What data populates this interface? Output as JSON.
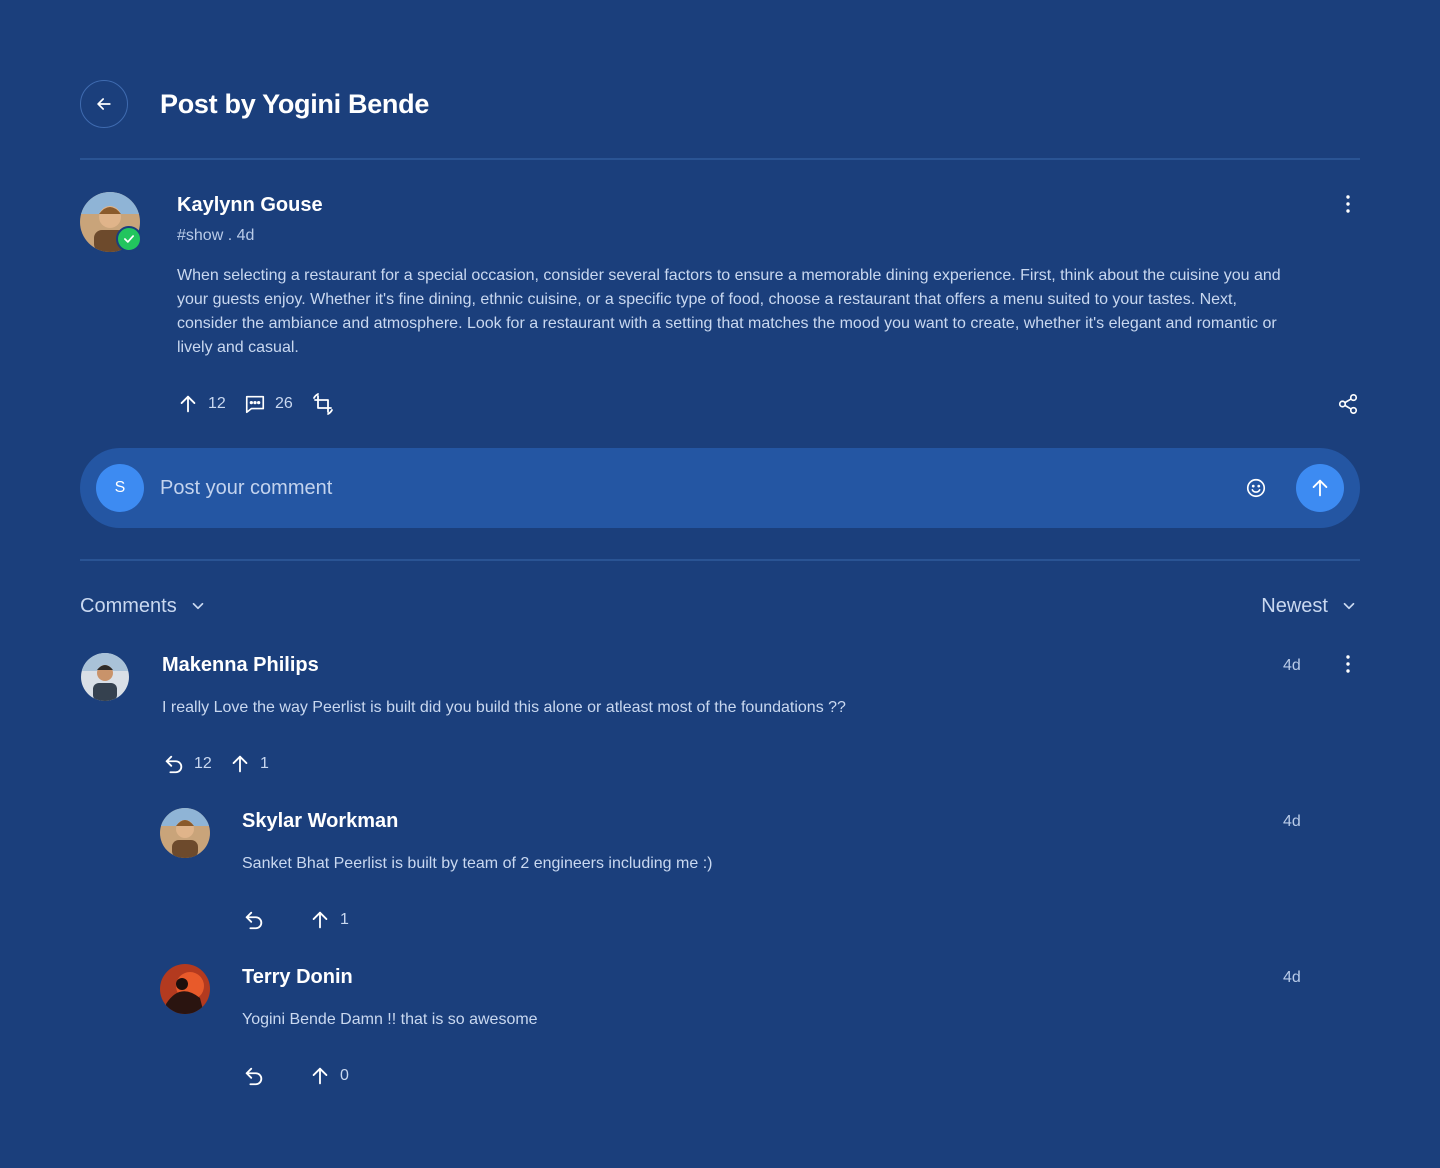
{
  "header": {
    "title": "Post by Yogini Bende"
  },
  "post": {
    "author": "Kaylynn Gouse",
    "tag_time": "#show . 4d",
    "body": "When selecting a restaurant for a special occasion, consider several factors to ensure a memorable dining experience. First, think about the cuisine you and your guests enjoy. Whether it's fine dining, ethnic cuisine, or a specific type of food, choose a restaurant that offers a menu suited to your tastes. Next, consider the ambiance and atmosphere. Look for a restaurant with a setting that matches the mood you want to create, whether it's elegant and romantic or lively and casual.",
    "upvotes": "12",
    "comments": "26"
  },
  "composer": {
    "avatar_initial": "S",
    "placeholder": "Post your comment"
  },
  "comments_header": {
    "label": "Comments",
    "sort": "Newest"
  },
  "comments": [
    {
      "author": "Makenna Philips",
      "time": "4d",
      "text": "I really Love the way Peerlist is built did you build this alone or atleast most of the foundations ??",
      "replies": "12",
      "upvotes": "1"
    },
    {
      "author": "Skylar Workman",
      "time": "4d",
      "text": "Sanket Bhat Peerlist is built by team of 2 engineers including me :)",
      "upvotes": "1"
    },
    {
      "author": "Terry Donin",
      "time": "4d",
      "text": "Yogini Bende Damn !! that is so awesome",
      "upvotes": "0"
    }
  ],
  "colors": {
    "background": "#1b3f7c",
    "composer": "#2456a3",
    "accent": "#3d8bf2",
    "verified": "#22c55e"
  }
}
